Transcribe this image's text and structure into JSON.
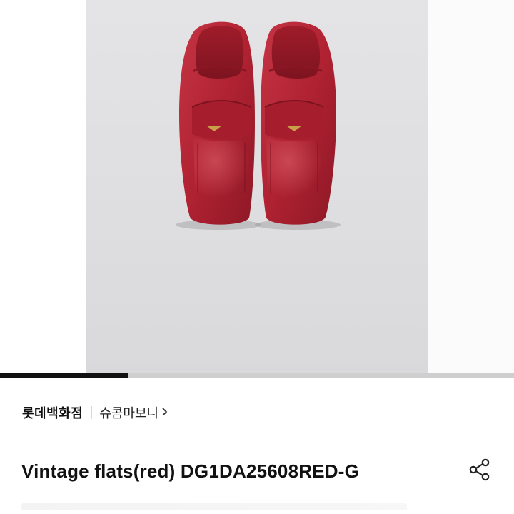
{
  "product": {
    "image_alt": "Red leather penny loafers",
    "gallery_progress_fraction": 0.25
  },
  "store": {
    "name": "롯데백화점",
    "brand": "슈콤마보니",
    "brand_chevron": "›"
  },
  "title": {
    "text": "Vintage flats(red) DG1DA25608RED-G"
  },
  "icons": {
    "share": "share-icon"
  },
  "colors": {
    "shoe_red": "#b52433",
    "background": "#dfdfe1",
    "progress_track": "#cfcfcf",
    "progress_fill": "#111111"
  }
}
